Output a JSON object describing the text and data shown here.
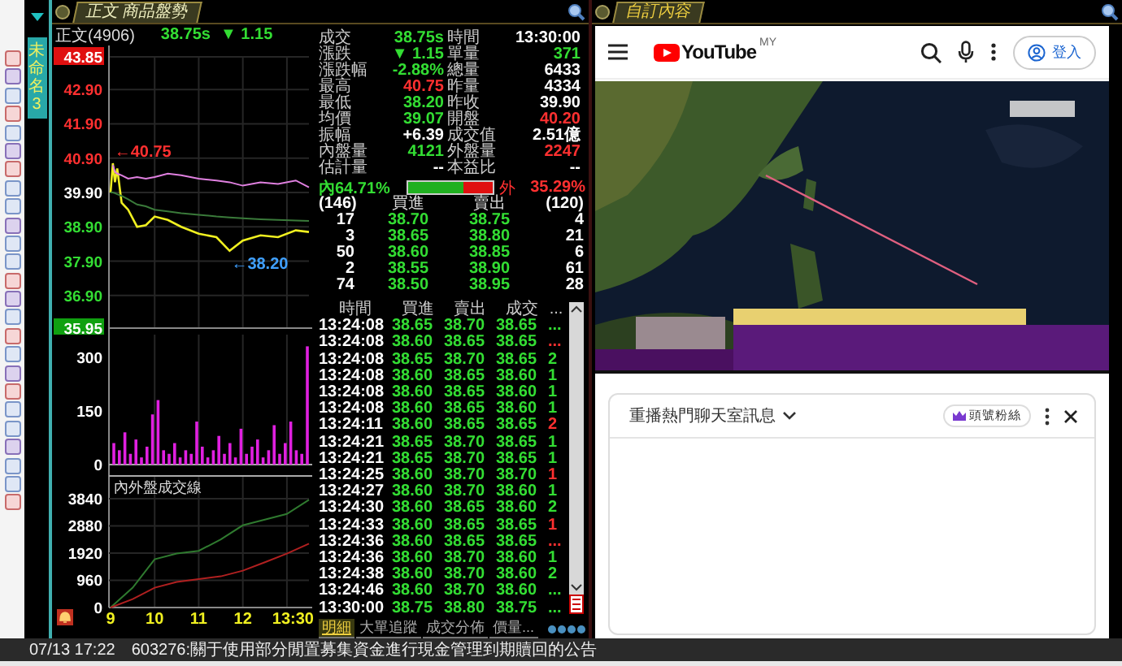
{
  "workspace_tab": {
    "label": "未命名3"
  },
  "main_panel": {
    "tab": "正文 商品盤勢",
    "quote": {
      "name": "正文(4906)",
      "price": "38.75s",
      "change": "▼ 1.15"
    },
    "price_chart": {
      "chart_data": {
        "type": "line",
        "x": [
          9,
          9.05,
          9.1,
          9.15,
          9.25,
          9.4,
          9.6,
          9.8,
          10,
          10.3,
          10.6,
          11,
          11.4,
          11.7,
          12,
          12.4,
          12.8,
          13.2,
          13.5
        ],
        "xlim": [
          9,
          13.5
        ],
        "ylim": [
          35.95,
          43.85
        ],
        "series": [
          {
            "color": "#f0f020",
            "values": [
              39.9,
              40.75,
              40.2,
              40.6,
              39.6,
              39.4,
              38.9,
              38.95,
              39.2,
              39.1,
              38.9,
              38.7,
              38.6,
              38.2,
              38.5,
              38.65,
              38.6,
              38.8,
              38.75
            ]
          },
          {
            "color": "#3a7a3a",
            "values": [
              39.9,
              39.9,
              39.88,
              39.85,
              39.8,
              39.7,
              39.55,
              39.5,
              39.4,
              39.35,
              39.3,
              39.25,
              39.2,
              39.17,
              39.15,
              39.12,
              39.1,
              39.08,
              39.07
            ]
          },
          {
            "color": "#e080e0",
            "values": [
              null,
              40.7,
              40.5,
              40.45,
              40.4,
              40.3,
              40.35,
              40.3,
              40.35,
              40.45,
              40.4,
              40.3,
              40.25,
              40.2,
              40.1,
              40.2,
              40.15,
              40.25,
              40.05
            ]
          }
        ],
        "yticks": [
          {
            "value": 43.85,
            "label": "43.85"
          },
          {
            "value": 42.9,
            "label": "42.90"
          },
          {
            "value": 41.9,
            "label": "41.90"
          },
          {
            "value": 40.9,
            "label": "40.90"
          },
          {
            "value": 39.9,
            "label": "39.90"
          },
          {
            "value": 38.9,
            "label": "38.90"
          },
          {
            "value": 37.9,
            "label": "37.90"
          },
          {
            "value": 36.9,
            "label": "36.90"
          },
          {
            "value": 35.95,
            "label": "35.95"
          }
        ],
        "grid": true,
        "annotations": [
          {
            "text": "←40.75",
            "x": 9.05,
            "y": 40.75
          },
          {
            "text": "←38.20",
            "x": 11.7,
            "y": 38.2
          }
        ]
      }
    },
    "volume_chart": {
      "chart_data": {
        "type": "bar",
        "values": [
          60,
          40,
          90,
          30,
          70,
          20,
          50,
          140,
          180,
          40,
          30,
          60,
          20,
          40,
          30,
          120,
          50,
          20,
          40,
          80,
          30,
          60,
          20,
          100,
          30,
          50,
          70,
          20,
          40,
          110,
          30,
          60,
          120,
          40,
          30,
          330
        ],
        "ylim": [
          0,
          340
        ],
        "yticks": [
          0,
          150,
          300
        ]
      }
    },
    "flow_chart": {
      "chart_data": {
        "type": "line",
        "title": "內外盤成交線",
        "x": [
          9,
          9.5,
          10,
          10.5,
          11,
          11.5,
          12,
          12.5,
          13,
          13.5
        ],
        "xlim": [
          9,
          13.5
        ],
        "ylim": [
          0,
          4640
        ],
        "grid": true,
        "series": [
          {
            "color": "#2f7a2f",
            "values": [
              0,
              700,
              1700,
              1900,
              2000,
              2400,
              2900,
              3100,
              3300,
              3800
            ]
          },
          {
            "color": "#b02020",
            "values": [
              0,
              300,
              700,
              900,
              1000,
              1100,
              1300,
              1600,
              1900,
              2250
            ]
          }
        ],
        "yticks": [
          0,
          960,
          1920,
          2880,
          3840
        ],
        "xticks": [
          9,
          10,
          11,
          12,
          {
            "value": 13.5,
            "label": "13:30"
          }
        ]
      }
    },
    "stats": [
      [
        {
          "label": "成交",
          "value": "38.75s",
          "color": "#33dd33"
        },
        {
          "label": "時間",
          "value": "13:30:00",
          "color": "#ffffff"
        }
      ],
      [
        {
          "label": "漲跌",
          "value": "▼ 1.15",
          "color": "#33dd33"
        },
        {
          "label": "單量",
          "value": "371",
          "color": "#33dd33"
        }
      ],
      [
        {
          "label": "漲跌幅",
          "value": "-2.88%",
          "color": "#33dd33"
        },
        {
          "label": "總量",
          "value": "6433",
          "color": "#ffffff"
        }
      ],
      [
        {
          "label": "最高",
          "value": "40.75",
          "color": "#ff3030"
        },
        {
          "label": "昨量",
          "value": "4334",
          "color": "#ffffff"
        }
      ],
      [
        {
          "label": "最低",
          "value": "38.20",
          "color": "#33dd33"
        },
        {
          "label": "昨收",
          "value": "39.90",
          "color": "#ffffff"
        }
      ],
      [
        {
          "label": "均價",
          "value": "39.07",
          "color": "#33dd33"
        },
        {
          "label": "開盤",
          "value": "40.20",
          "color": "#ff3030"
        }
      ],
      [
        {
          "label": "振幅",
          "value": "+6.39",
          "color": "#ffffff"
        },
        {
          "label": "成交值",
          "value": "2.51億",
          "color": "#ffffff"
        }
      ],
      [
        {
          "label": "內盤量",
          "value": "4121",
          "color": "#33dd33"
        },
        {
          "label": "外盤量",
          "value": "2247",
          "color": "#ff3030"
        }
      ],
      [
        {
          "label": "估計量",
          "value": "--",
          "color": "#ffffff"
        },
        {
          "label": "本益比",
          "value": "--",
          "color": "#ffffff"
        }
      ]
    ],
    "ratio": {
      "inner": "內64.71%",
      "outer": "外",
      "outer_value": "35.29%",
      "level": 0.6471
    },
    "order_book": {
      "columns": [
        "(146)",
        "買進",
        "賣出",
        "(120)"
      ],
      "rows": [
        [
          "17",
          "38.70",
          "38.75",
          "4"
        ],
        [
          "3",
          "38.65",
          "38.80",
          "21"
        ],
        [
          "50",
          "38.60",
          "38.85",
          "6"
        ],
        [
          "2",
          "38.55",
          "38.90",
          "61"
        ],
        [
          "74",
          "38.50",
          "38.95",
          "28"
        ]
      ]
    },
    "trades": {
      "columns": [
        "時間",
        "買進",
        "賣出",
        "成交",
        "..."
      ],
      "rows": [
        {
          "time": "13:24:08",
          "bid": "38.65",
          "ask": "38.70",
          "price": "38.65",
          "qty": "...",
          "color": "#33dd33"
        },
        {
          "time": "13:24:08",
          "bid": "38.60",
          "ask": "38.65",
          "price": "38.65",
          "qty": "...",
          "color": "#ff3030"
        },
        {
          "time": "13:24:08",
          "bid": "38.65",
          "ask": "38.70",
          "price": "38.65",
          "qty": "2",
          "color": "#33dd33"
        },
        {
          "time": "13:24:08",
          "bid": "38.60",
          "ask": "38.65",
          "price": "38.60",
          "qty": "1",
          "color": "#33dd33"
        },
        {
          "time": "13:24:08",
          "bid": "38.60",
          "ask": "38.65",
          "price": "38.60",
          "qty": "1",
          "color": "#33dd33"
        },
        {
          "time": "13:24:08",
          "bid": "38.60",
          "ask": "38.65",
          "price": "38.60",
          "qty": "1",
          "color": "#33dd33"
        },
        {
          "time": "13:24:11",
          "bid": "38.60",
          "ask": "38.65",
          "price": "38.65",
          "qty": "2",
          "color": "#ff3030"
        },
        {
          "time": "13:24:21",
          "bid": "38.65",
          "ask": "38.70",
          "price": "38.65",
          "qty": "1",
          "color": "#33dd33"
        },
        {
          "time": "13:24:21",
          "bid": "38.65",
          "ask": "38.70",
          "price": "38.65",
          "qty": "1",
          "color": "#33dd33"
        },
        {
          "time": "13:24:25",
          "bid": "38.60",
          "ask": "38.70",
          "price": "38.70",
          "qty": "1",
          "color": "#ff3030"
        },
        {
          "time": "13:24:27",
          "bid": "38.60",
          "ask": "38.70",
          "price": "38.60",
          "qty": "1",
          "color": "#33dd33"
        },
        {
          "time": "13:24:30",
          "bid": "38.60",
          "ask": "38.65",
          "price": "38.60",
          "qty": "2",
          "color": "#33dd33"
        },
        {
          "time": "13:24:33",
          "bid": "38.60",
          "ask": "38.65",
          "price": "38.65",
          "qty": "1",
          "color": "#ff3030"
        },
        {
          "time": "13:24:36",
          "bid": "38.60",
          "ask": "38.65",
          "price": "38.65",
          "qty": "...",
          "color": "#ff3030"
        },
        {
          "time": "13:24:36",
          "bid": "38.60",
          "ask": "38.70",
          "price": "38.60",
          "qty": "1",
          "color": "#33dd33"
        },
        {
          "time": "13:24:38",
          "bid": "38.60",
          "ask": "38.70",
          "price": "38.60",
          "qty": "2",
          "color": "#33dd33"
        },
        {
          "time": "13:24:46",
          "bid": "38.60",
          "ask": "38.70",
          "price": "38.60",
          "qty": "...",
          "color": "#33dd33"
        },
        {
          "time": "13:30:00",
          "bid": "38.75",
          "ask": "38.80",
          "price": "38.75",
          "qty": "...",
          "color": "#33dd33"
        }
      ]
    },
    "bottom_tabs": [
      {
        "label": "明細",
        "selected": true
      },
      {
        "label": "大單追蹤",
        "selected": false
      },
      {
        "label": "成交分佈",
        "selected": false
      },
      {
        "label": "價量...",
        "selected": false
      }
    ]
  },
  "side_panel": {
    "tab": "自訂內容",
    "youtube": {
      "logo": "YouTube",
      "region": "MY",
      "sign_in": "登入"
    },
    "chat": {
      "title": "重播熱門聊天室訊息",
      "chip": "頭號粉絲"
    }
  },
  "status_bar": {
    "time": "07/13 17:22",
    "message": "603276:關于使用部分閒置募集資金進行現金管理到期贖回的公告"
  }
}
